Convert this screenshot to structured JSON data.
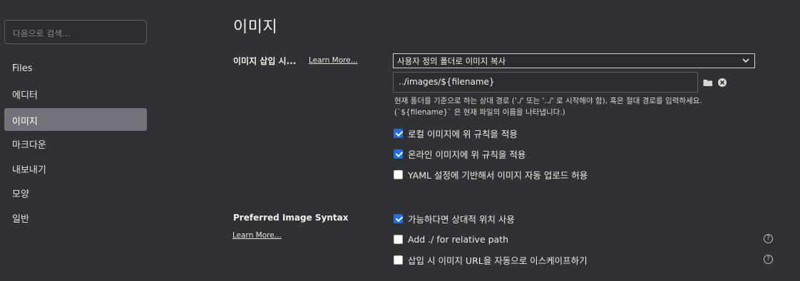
{
  "sidebar": {
    "search_placeholder": "다음으로 검색...",
    "items": [
      {
        "label": "Files"
      },
      {
        "label": "에디터"
      },
      {
        "label": "이미지",
        "active": true
      },
      {
        "label": "마크다운"
      },
      {
        "label": "내보내기"
      },
      {
        "label": "모양"
      },
      {
        "label": "일반"
      }
    ]
  },
  "main": {
    "title": "이미지",
    "insert_section": {
      "label": "이미지 삽입 시...",
      "learn_more": "Learn More...",
      "select_value": "사용자 정의 폴더로 이미지 복사",
      "path_value": "../images/${filename}",
      "folder_icon": "folder-icon",
      "clear_icon": "clear-icon",
      "description_line1": "현재 폴더를 기준으로 하는 상대 경로 ('./' 또는 '../' 로 시작해야 함), 혹은 절대 경로를 입력하세요.",
      "description_line2": "(`${filename}` 은 현재 파일의 이름을 나타냅니다.)",
      "options": [
        {
          "label": "로컬 이미지에 위 규칙을 적용",
          "checked": true
        },
        {
          "label": "온라인 이미지에 위 규칙을 적용",
          "checked": true
        },
        {
          "label": "YAML 설정에 기반해서 이미지 자동 업로드 허용",
          "checked": false
        }
      ]
    },
    "syntax_section": {
      "label": "Preferred Image Syntax",
      "learn_more": "Learn More...",
      "options": [
        {
          "label": "가능하다면 상대적 위치 사용",
          "checked": true,
          "help": false
        },
        {
          "label": "Add ./ for relative path",
          "checked": false,
          "help": true
        },
        {
          "label": "삽입 시 이미지 URL을 자동으로 이스케이프하기",
          "checked": false,
          "help": true
        }
      ],
      "help_glyph": "?"
    }
  },
  "colors": {
    "background": "#2f3135",
    "active_item": "#71727a",
    "checkbox_accent": "#1f6fdc"
  }
}
